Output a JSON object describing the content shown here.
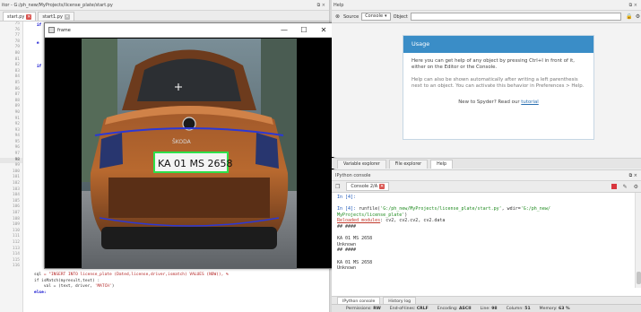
{
  "editor": {
    "path_title": "itor - G:/ph_new/MyProjects/license_plate/start.py",
    "pane_controls": "⧉ ×",
    "tabs": [
      {
        "label": "start.py",
        "active": true
      },
      {
        "label": "start1.py",
        "active": false
      }
    ],
    "line_numbers": [
      "75",
      "76",
      "77",
      "78",
      "79",
      "80",
      "81",
      "82",
      "83",
      "84",
      "85",
      "86",
      "87",
      "88",
      "89",
      "90",
      "91",
      "92",
      "93",
      "94",
      "95",
      "96",
      "97",
      "98",
      "99",
      "100",
      "101",
      "102",
      "103",
      "104",
      "105",
      "106",
      "107",
      "108",
      "109",
      "110",
      "111",
      "112",
      "113",
      "114",
      "115",
      "116"
    ],
    "current_line": "98",
    "code_fragments": {
      "l75": "    if",
      "l76": "        t",
      "l78": "    e",
      "l79": "        o",
      "l82": "    if"
    },
    "code_bottom": {
      "sql_kw": "sql",
      "sql_str": " = \"INSERT INTO license_plate (Dated,license,driver,ismatch) VALUES (NOW(), %",
      "if_line": "if isMatch(myresult,text) :",
      "val_line": "    val = (text, driver, ",
      "val_str": "'MATCH'",
      "val_end": ")",
      "else_line": "else:"
    }
  },
  "frame_window": {
    "title": "frame",
    "minimize": "—",
    "maximize": "☐",
    "close": "✕",
    "plate_text": "KA 01 MS 2658",
    "badge_text": "ŠKODA"
  },
  "help": {
    "pane_title": "Help",
    "pane_controls": "⧉ ×",
    "source_label": "Source",
    "source_value": "Console",
    "object_label": "Object",
    "usage": {
      "heading": "Usage",
      "p1": "Here you can get help of any object by pressing Ctrl+I in front of it, either on the Editor or the Console.",
      "p2": "Help can also be shown automatically after writing a left parenthesis next to an object. You can activate this behavior in Preferences > Help.",
      "footer_text": "New to Spyder? Read our ",
      "footer_link": "tutorial"
    }
  },
  "mid_tabs": [
    "Variable explorer",
    "File explorer",
    "Help"
  ],
  "console": {
    "pane_title": "IPython console",
    "pane_controls": "⧉ ×",
    "tab_label": "Console 2/A",
    "lines": {
      "in4a": "In [4]:",
      "in4b_prompt": "In [4]: ",
      "in4b_cmd": "runfile(",
      "in4b_path": "'G:/ph_new/MyProjects/license_plate/start.py'",
      "in4b_mid": ", wdir=",
      "in4b_dir": "'G:/ph_new/",
      "in4b_cont": "MyProjects/license_plate'",
      "in4b_close": ")",
      "reloaded": "Reloaded modules",
      "reloaded_rest": ": cv2, cv2.cv2, cv2.data",
      "hashes1": "## ####",
      "plate1": "KA 01 MS 2658",
      "unknown1": "Unknown",
      "hashes2": "## ####",
      "plate2": "KA 01 MS 2658",
      "unknown2": "Unknown"
    },
    "bottom_tabs": [
      "IPython console",
      "History log"
    ]
  },
  "statusbar": {
    "permissions_label": "Permissions:",
    "permissions": "RW",
    "eol_label": "End-of-lines:",
    "eol": "CRLF",
    "encoding_label": "Encoding:",
    "encoding": "ASCII",
    "line_label": "Line:",
    "line": "98",
    "column_label": "Column:",
    "column": "51",
    "memory_label": "Memory:",
    "memory": "63 %"
  },
  "colors": {
    "accent": "#3a8dc7",
    "close_red": "#d9534f",
    "plate_green": "#2ee04a"
  }
}
